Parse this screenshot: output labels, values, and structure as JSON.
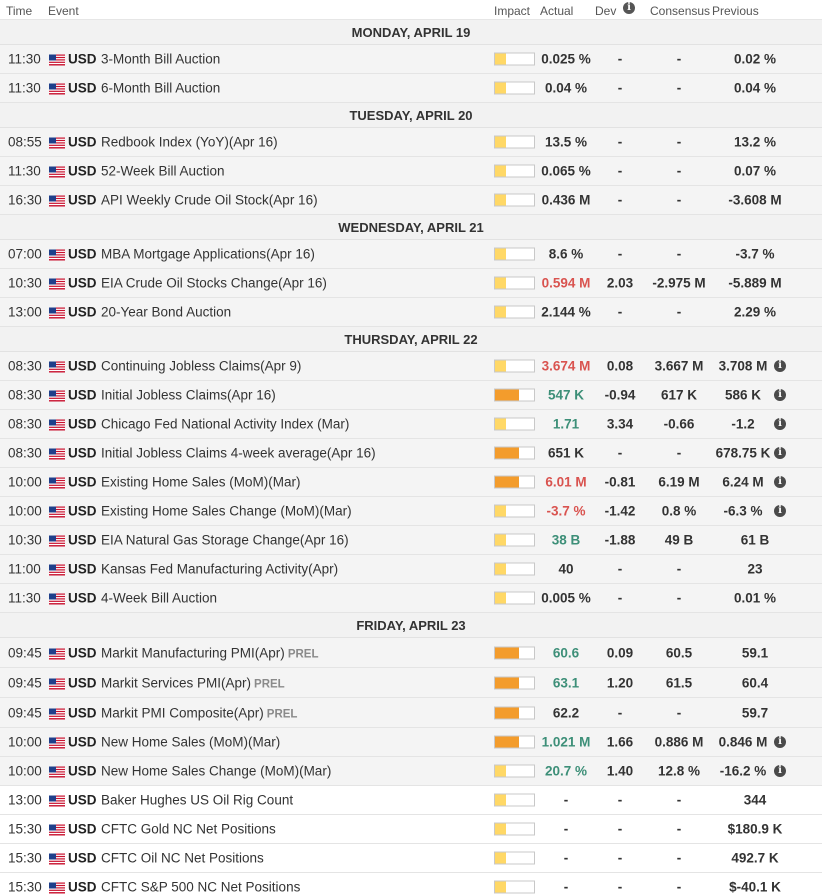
{
  "header": {
    "time": "Time",
    "event": "Event",
    "impact": "Impact",
    "actual": "Actual",
    "dev": "Dev",
    "consensus": "Consensus",
    "previous": "Previous"
  },
  "colors": {
    "impact_low": "#ffd866",
    "impact_medium": "#f39c2c",
    "actual_negative": "#d9534f",
    "actual_positive": "#3d8f78",
    "actual_neutral": "#333333"
  },
  "sections": [
    {
      "day": "MONDAY, APRIL 19",
      "events": [
        {
          "time": "11:30",
          "currency": "USD",
          "name": "3-Month Bill Auction",
          "impact": 1,
          "actual": "0.025 %",
          "actual_status": "neutral",
          "dev": "-",
          "consensus": "-",
          "previous": "0.02 %",
          "info": false
        },
        {
          "time": "11:30",
          "currency": "USD",
          "name": "6-Month Bill Auction",
          "impact": 1,
          "actual": "0.04 %",
          "actual_status": "neutral",
          "dev": "-",
          "consensus": "-",
          "previous": "0.04 %",
          "info": false
        }
      ]
    },
    {
      "day": "TUESDAY, APRIL 20",
      "events": [
        {
          "time": "08:55",
          "currency": "USD",
          "name": "Redbook Index (YoY)(Apr 16)",
          "impact": 1,
          "actual": "13.5 %",
          "actual_status": "neutral",
          "dev": "-",
          "consensus": "-",
          "previous": "13.2 %",
          "info": false
        },
        {
          "time": "11:30",
          "currency": "USD",
          "name": "52-Week Bill Auction",
          "impact": 1,
          "actual": "0.065 %",
          "actual_status": "neutral",
          "dev": "-",
          "consensus": "-",
          "previous": "0.07 %",
          "info": false
        },
        {
          "time": "16:30",
          "currency": "USD",
          "name": "API Weekly Crude Oil Stock(Apr 16)",
          "impact": 1,
          "actual": "0.436 M",
          "actual_status": "neutral",
          "dev": "-",
          "consensus": "-",
          "previous": "-3.608 M",
          "info": false
        }
      ]
    },
    {
      "day": "WEDNESDAY, APRIL 21",
      "events": [
        {
          "time": "07:00",
          "currency": "USD",
          "name": "MBA Mortgage Applications(Apr 16)",
          "impact": 1,
          "actual": "8.6 %",
          "actual_status": "neutral",
          "dev": "-",
          "consensus": "-",
          "previous": "-3.7 %",
          "info": false
        },
        {
          "time": "10:30",
          "currency": "USD",
          "name": "EIA Crude Oil Stocks Change(Apr 16)",
          "impact": 1,
          "actual": "0.594 M",
          "actual_status": "negative",
          "dev": "2.03",
          "consensus": "-2.975 M",
          "previous": "-5.889 M",
          "info": false
        },
        {
          "time": "13:00",
          "currency": "USD",
          "name": "20-Year Bond Auction",
          "impact": 1,
          "actual": "2.144 %",
          "actual_status": "neutral",
          "dev": "-",
          "consensus": "-",
          "previous": "2.29 %",
          "info": false
        }
      ]
    },
    {
      "day": "THURSDAY, APRIL 22",
      "events": [
        {
          "time": "08:30",
          "currency": "USD",
          "name": "Continuing Jobless Claims(Apr 9)",
          "impact": 1,
          "actual": "3.674 M",
          "actual_status": "negative",
          "dev": "0.08",
          "consensus": "3.667 M",
          "previous": "3.708 M",
          "info": true
        },
        {
          "time": "08:30",
          "currency": "USD",
          "name": "Initial Jobless Claims(Apr 16)",
          "impact": 2,
          "actual": "547 K",
          "actual_status": "positive",
          "dev": "-0.94",
          "consensus": "617 K",
          "previous": "586 K",
          "info": true
        },
        {
          "time": "08:30",
          "currency": "USD",
          "name": "Chicago Fed National Activity Index (Mar)",
          "impact": 1,
          "actual": "1.71",
          "actual_status": "positive",
          "dev": "3.34",
          "consensus": "-0.66",
          "previous": "-1.2",
          "info": true
        },
        {
          "time": "08:30",
          "currency": "USD",
          "name": "Initial Jobless Claims 4-week average(Apr 16)",
          "impact": 2,
          "actual": "651 K",
          "actual_status": "neutral",
          "dev": "-",
          "consensus": "-",
          "previous": "678.75 K",
          "info": true
        },
        {
          "time": "10:00",
          "currency": "USD",
          "name": "Existing Home Sales (MoM)(Mar)",
          "impact": 2,
          "actual": "6.01 M",
          "actual_status": "negative",
          "dev": "-0.81",
          "consensus": "6.19 M",
          "previous": "6.24 M",
          "info": true
        },
        {
          "time": "10:00",
          "currency": "USD",
          "name": "Existing Home Sales Change (MoM)(Mar)",
          "impact": 1,
          "actual": "-3.7 %",
          "actual_status": "negative",
          "dev": "-1.42",
          "consensus": "0.8 %",
          "previous": "-6.3 %",
          "info": true
        },
        {
          "time": "10:30",
          "currency": "USD",
          "name": "EIA Natural Gas Storage Change(Apr 16)",
          "impact": 1,
          "actual": "38 B",
          "actual_status": "positive",
          "dev": "-1.88",
          "consensus": "49 B",
          "previous": "61 B",
          "info": false
        },
        {
          "time": "11:00",
          "currency": "USD",
          "name": "Kansas Fed Manufacturing Activity(Apr)",
          "impact": 1,
          "actual": "40",
          "actual_status": "neutral",
          "dev": "-",
          "consensus": "-",
          "previous": "23",
          "info": false
        },
        {
          "time": "11:30",
          "currency": "USD",
          "name": "4-Week Bill Auction",
          "impact": 1,
          "actual": "0.005 %",
          "actual_status": "neutral",
          "dev": "-",
          "consensus": "-",
          "previous": "0.01 %",
          "info": false
        }
      ]
    },
    {
      "day": "FRIDAY, APRIL 23",
      "events": [
        {
          "time": "09:45",
          "currency": "USD",
          "name": "Markit Manufacturing PMI(Apr)",
          "tag": "PREL",
          "impact": 2,
          "actual": "60.6",
          "actual_status": "positive",
          "dev": "0.09",
          "consensus": "60.5",
          "previous": "59.1",
          "info": false
        },
        {
          "time": "09:45",
          "currency": "USD",
          "name": "Markit Services PMI(Apr)",
          "tag": "PREL",
          "impact": 2,
          "actual": "63.1",
          "actual_status": "positive",
          "dev": "1.20",
          "consensus": "61.5",
          "previous": "60.4",
          "info": false
        },
        {
          "time": "09:45",
          "currency": "USD",
          "name": "Markit PMI Composite(Apr)",
          "tag": "PREL",
          "impact": 2,
          "actual": "62.2",
          "actual_status": "neutral",
          "dev": "-",
          "consensus": "-",
          "previous": "59.7",
          "info": false
        },
        {
          "time": "10:00",
          "currency": "USD",
          "name": "New Home Sales (MoM)(Mar)",
          "impact": 2,
          "actual": "1.021 M",
          "actual_status": "positive",
          "dev": "1.66",
          "consensus": "0.886 M",
          "previous": "0.846 M",
          "info": true
        },
        {
          "time": "10:00",
          "currency": "USD",
          "name": "New Home Sales Change (MoM)(Mar)",
          "impact": 1,
          "actual": "20.7 %",
          "actual_status": "positive",
          "dev": "1.40",
          "consensus": "12.8 %",
          "previous": "-16.2 %",
          "info": true
        },
        {
          "time": "13:00",
          "currency": "USD",
          "name": "Baker Hughes US Oil Rig Count",
          "impact": 1,
          "actual": "-",
          "actual_status": "neutral",
          "dev": "-",
          "consensus": "-",
          "previous": "344",
          "info": false,
          "upcoming": true
        },
        {
          "time": "15:30",
          "currency": "USD",
          "name": "CFTC Gold NC Net Positions",
          "impact": 1,
          "actual": "-",
          "actual_status": "neutral",
          "dev": "-",
          "consensus": "-",
          "previous": "$180.9 K",
          "info": false,
          "upcoming": true
        },
        {
          "time": "15:30",
          "currency": "USD",
          "name": "CFTC Oil NC Net Positions",
          "impact": 1,
          "actual": "-",
          "actual_status": "neutral",
          "dev": "-",
          "consensus": "-",
          "previous": "492.7 K",
          "info": false,
          "upcoming": true
        },
        {
          "time": "15:30",
          "currency": "USD",
          "name": "CFTC S&P 500 NC Net Positions",
          "impact": 1,
          "actual": "-",
          "actual_status": "neutral",
          "dev": "-",
          "consensus": "-",
          "previous": "$-40.1 K",
          "info": false,
          "upcoming": true
        }
      ]
    }
  ]
}
